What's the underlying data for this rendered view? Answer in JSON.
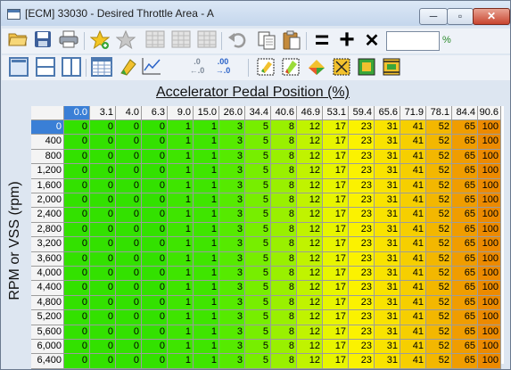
{
  "window": {
    "title": "[ECM] 33030 - Desired Throttle Area - A",
    "min_glyph": "─",
    "max_glyph": "▫",
    "close_glyph": "✕"
  },
  "toolbar1": {
    "icons": [
      "open-folder-icon",
      "save-disk-icon",
      "print-icon",
      "star-add-icon",
      "star-remove-icon",
      "table-grid-icon",
      "table-grid-icon",
      "table-grid-icon",
      "undo-icon",
      "copy-icon",
      "paste-icon",
      "equals-icon",
      "plus-icon",
      "multiply-icon"
    ],
    "equals_glyph": "=",
    "plus_glyph": "+",
    "multiply_glyph": "✕",
    "percent_value": "",
    "percent_label": "%"
  },
  "toolbar2": {
    "icons": [
      "layout-single-icon",
      "layout-horizontal-split-icon",
      "layout-vertical-split-icon",
      "table-view-icon",
      "color-marker-icon",
      "line-graph-icon",
      "decrease-decimals-icon",
      "increase-decimals-icon",
      "select-cells-icon",
      "color-fill-icon",
      "color-gradient-icon",
      "select-region-icon",
      "highlight-icon",
      "fit-icon"
    ],
    "decrease_decimals_top": ".0",
    "decrease_decimals_bottom": "←.0",
    "increase_decimals_top": ".00",
    "increase_decimals_bottom": "→.0"
  },
  "axes": {
    "x_label": "Accelerator Pedal Position (%)",
    "y_label": "RPM or VSS (rpm)"
  },
  "table": {
    "col_headers": [
      "0.0",
      "3.1",
      "4.0",
      "6.3",
      "9.0",
      "15.0",
      "26.0",
      "34.4",
      "40.6",
      "46.9",
      "53.1",
      "59.4",
      "65.6",
      "71.9",
      "78.1",
      "84.4",
      "90.6"
    ],
    "row_headers": [
      "0",
      "400",
      "800",
      "1,200",
      "1,600",
      "2,000",
      "2,400",
      "2,800",
      "3,200",
      "3,600",
      "4,000",
      "4,400",
      "4,800",
      "5,200",
      "5,600",
      "6,000",
      "6,400"
    ],
    "selected_col_index": 0,
    "selected_row_index": 0,
    "row_values": [
      "0",
      "0",
      "0",
      "0",
      "1",
      "1",
      "3",
      "5",
      "8",
      "12",
      "17",
      "23",
      "31",
      "41",
      "52",
      "65",
      "100"
    ],
    "value_colors": {
      "0": "#33e100",
      "1": "#3fe500",
      "3": "#56ea00",
      "5": "#77ee00",
      "8": "#99f000",
      "12": "#c0f300",
      "17": "#e8f500",
      "23": "#fbf200",
      "31": "#f9e300",
      "41": "#f6cf00",
      "52": "#f3b700",
      "65": "#f09d00",
      "100": "#ec8a00"
    }
  }
}
